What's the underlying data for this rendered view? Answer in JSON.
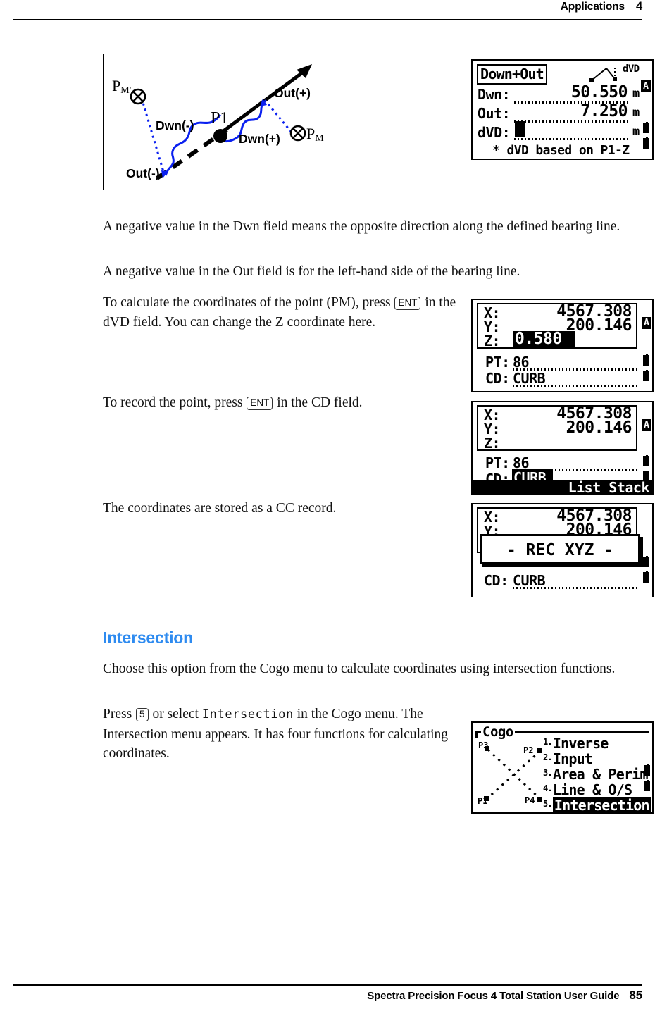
{
  "header": {
    "section": "Applications",
    "chapter": "4"
  },
  "footer": {
    "guide": "Spectra Precision Focus 4 Total Station User Guide",
    "page": "85"
  },
  "figure": {
    "name": "down-and-out-bearing-diagram",
    "labels": {
      "pm_prime": "P",
      "pm_prime_sub": "M'",
      "pm": "P",
      "pm_sub": "M",
      "p1": "P1",
      "dwn_neg": "Dwn(-)",
      "dwn_pos": "Dwn(+)",
      "out_neg": "Out(-)",
      "out_pos": "Out(+)"
    }
  },
  "paragraphs": {
    "p_dwn_negative": "A negative value in the Dwn field means the opposite direction along the defined bearing line.",
    "p_out_negative": "A negative value in the Out field is for the left-hand side of the bearing line.",
    "p_calc_a": "To calculate the coordinates of the point (PM), press",
    "p_calc_key": "ENT",
    "p_calc_b": "in the dVD field. You can change the Z coordinate here.",
    "p_record_a": "To record the point, press",
    "p_record_key": "ENT",
    "p_record_b": "in the CD field.",
    "p_cc_record": "The coordinates are stored as a CC record.",
    "p_intersection_intro": "Choose this option from the Cogo menu to calculate coordinates using intersection functions.",
    "p_press5_a": "Press",
    "p_press5_key": "5",
    "p_press5_b": "or select",
    "p_press5_lcd": "Intersection",
    "p_press5_c": "in the Cogo menu. The Intersection menu appears. It has four functions for calculating coordinates."
  },
  "headings": {
    "intersection": "Intersection"
  },
  "screens": {
    "down_out": {
      "title": "Down+Out",
      "icon_label": "dVD",
      "mode_badge": "A",
      "rows": [
        {
          "label": "Dwn:",
          "value": "50.550",
          "unit": "m"
        },
        {
          "label": "Out:",
          "value": "7.250",
          "unit": "m"
        },
        {
          "label": "dVD:",
          "value": "",
          "unit": "m"
        }
      ],
      "footer_note": "* dVD based on P1-Z"
    },
    "coord_z_edit": {
      "mode_badge": "A",
      "x_label": "X:",
      "x_value": "4567.308",
      "y_label": "Y:",
      "y_value": "200.146",
      "z_label": "Z:",
      "z_value": "0.580",
      "pt_label": "PT:",
      "pt_value": "86",
      "cd_label": "CD:",
      "cd_value": "CURB"
    },
    "coord_cd_edit": {
      "mode_badge": "A",
      "x_label": "X:",
      "x_value": "4567.308",
      "y_label": "Y:",
      "y_value": "200.146",
      "z_label": "Z:",
      "z_value": "",
      "pt_label": "PT:",
      "pt_value": "86",
      "cd_label": "CD:",
      "cd_value": "CURB",
      "softkeys": "List Stack"
    },
    "rec_xyz": {
      "x_label": "X:",
      "x_value": "4567.308",
      "y_label": "Y:",
      "y_value": "200.146",
      "dialog": "- REC XYZ -",
      "cd_label": "CD:",
      "cd_value": "CURB"
    },
    "cogo_menu": {
      "title": "Cogo",
      "point_labels": [
        "P3",
        "P2",
        "P1",
        "P4"
      ],
      "items": [
        {
          "num": "1.",
          "label": "Inverse",
          "selected": false
        },
        {
          "num": "2.",
          "label": "Input",
          "selected": false
        },
        {
          "num": "3.",
          "label": "Area & Perim",
          "selected": false
        },
        {
          "num": "4.",
          "label": "Line & O/S",
          "selected": false
        },
        {
          "num": "5.",
          "label": "Intersection",
          "selected": true
        }
      ]
    }
  },
  "colors": {
    "heading_blue": "#2e8bf0",
    "diagram_blue": "#0a20f0",
    "ink": "#000000"
  }
}
